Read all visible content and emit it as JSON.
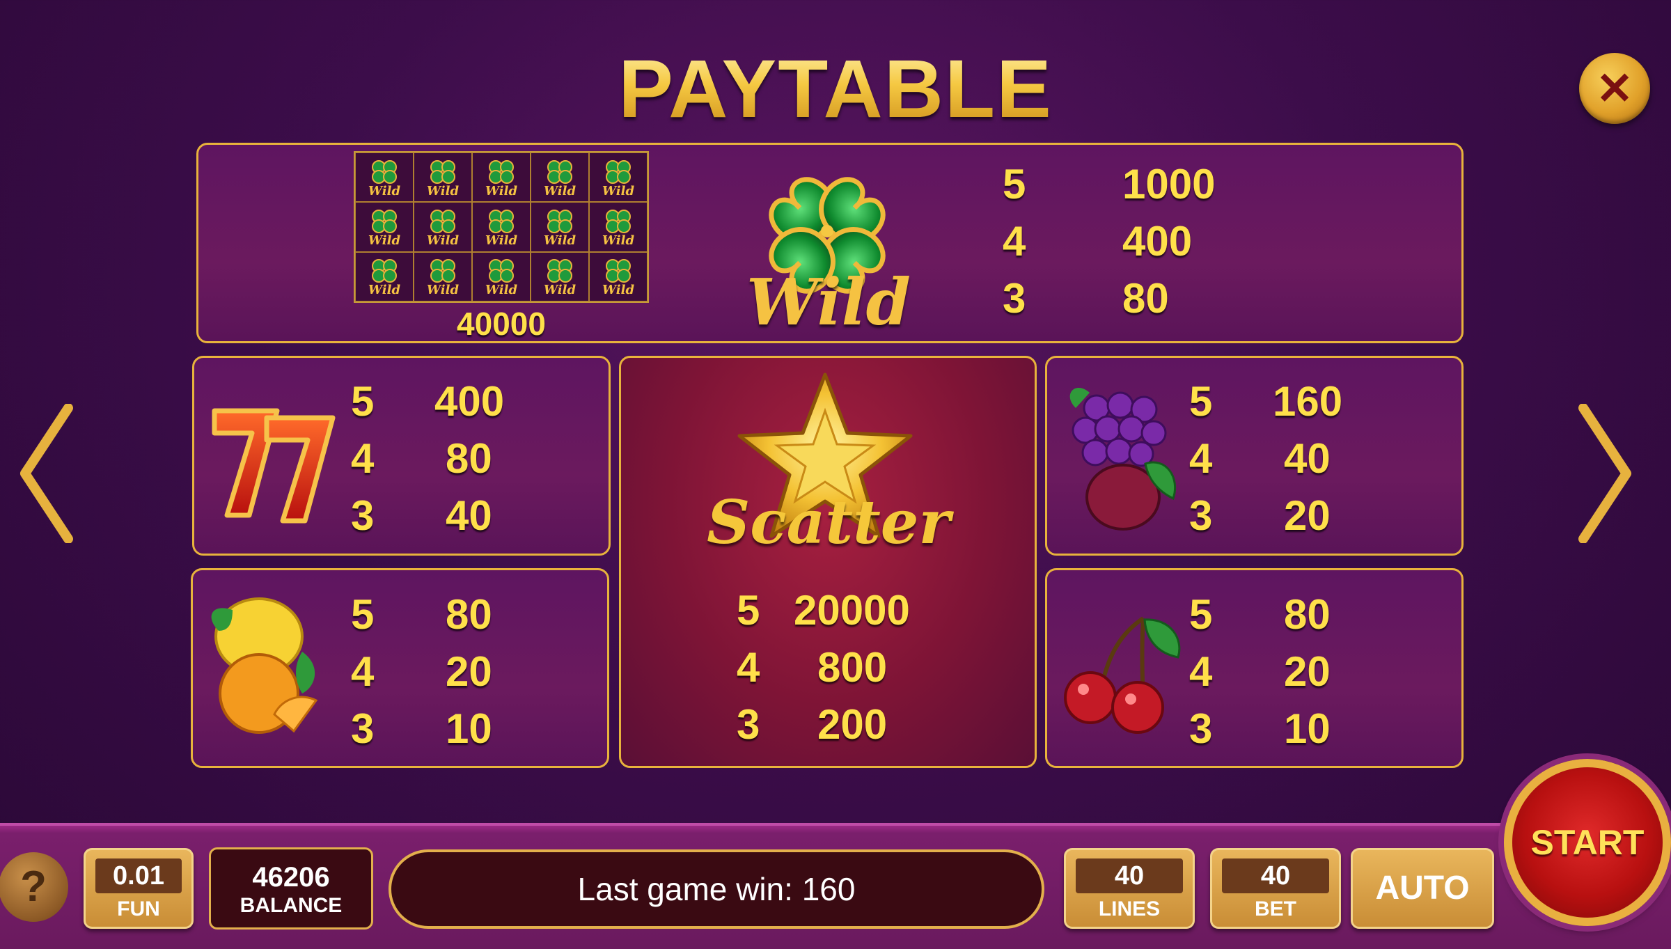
{
  "title": "PAYTABLE",
  "wild": {
    "mini_total": "40000",
    "mini_label": "Wild",
    "label": "Wild",
    "pays": [
      {
        "count": "5",
        "value": "1000"
      },
      {
        "count": "4",
        "value": "400"
      },
      {
        "count": "3",
        "value": "80"
      }
    ]
  },
  "seven": {
    "pays": [
      {
        "count": "5",
        "value": "400"
      },
      {
        "count": "4",
        "value": "80"
      },
      {
        "count": "3",
        "value": "40"
      }
    ]
  },
  "scatter": {
    "label": "Scatter",
    "pays": [
      {
        "count": "5",
        "value": "20000"
      },
      {
        "count": "4",
        "value": "800"
      },
      {
        "count": "3",
        "value": "200"
      }
    ]
  },
  "grapes": {
    "pays": [
      {
        "count": "5",
        "value": "160"
      },
      {
        "count": "4",
        "value": "40"
      },
      {
        "count": "3",
        "value": "20"
      }
    ]
  },
  "citrus": {
    "pays": [
      {
        "count": "5",
        "value": "80"
      },
      {
        "count": "4",
        "value": "20"
      },
      {
        "count": "3",
        "value": "10"
      }
    ]
  },
  "cherry": {
    "pays": [
      {
        "count": "5",
        "value": "80"
      },
      {
        "count": "4",
        "value": "20"
      },
      {
        "count": "3",
        "value": "10"
      }
    ]
  },
  "bottom": {
    "help": "?",
    "coin_value": "0.01",
    "coin_label": "FUN",
    "balance_value": "46206",
    "balance_label": "BALANCE",
    "last_win": "Last game win: 160",
    "lines_value": "40",
    "lines_label": "LINES",
    "bet_value": "40",
    "bet_label": "BET",
    "auto": "AUTO",
    "start": "START"
  },
  "close_glyph": "✕"
}
